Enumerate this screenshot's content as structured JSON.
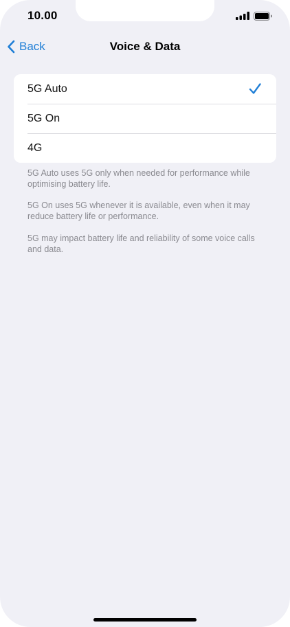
{
  "status_bar": {
    "time": "10.00"
  },
  "nav": {
    "back_label": "Back",
    "title": "Voice & Data"
  },
  "options": [
    {
      "label": "5G Auto",
      "selected": true
    },
    {
      "label": "5G On",
      "selected": false
    },
    {
      "label": "4G",
      "selected": false
    }
  ],
  "notes": [
    "5G Auto uses 5G only when needed for performance while optimising battery life.",
    "5G On uses 5G whenever it is available, even when it may reduce battery life or performance.",
    "5G may impact battery life and reliability of some voice calls and data."
  ],
  "colors": {
    "accent": "#1f7ed6",
    "background": "#f0f0f6",
    "card": "#ffffff",
    "secondary_text": "#8a8a90"
  },
  "icons": {
    "back": "chevron-left-icon",
    "selected": "checkmark-icon",
    "signal": "cellular-signal-icon",
    "battery": "battery-icon"
  }
}
